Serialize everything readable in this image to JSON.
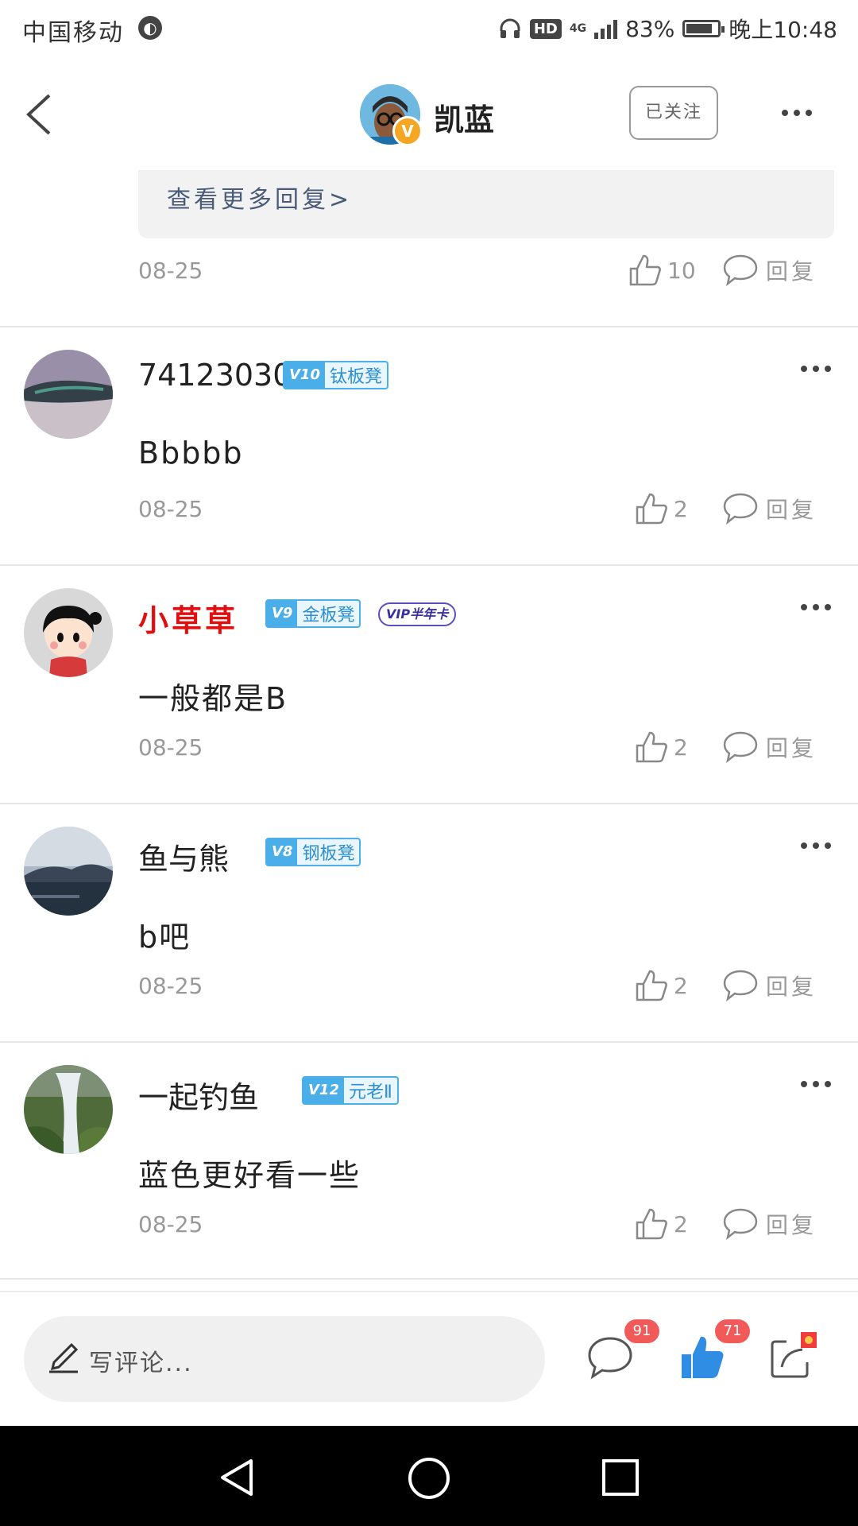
{
  "status_bar": {
    "carrier": "中国移动",
    "network": "4G",
    "hd_label": "HD",
    "battery": "83%",
    "time": "晚上10:48",
    "battery_level": 0.83
  },
  "header": {
    "user_name": "凯蓝",
    "follow_label": "已关注",
    "verified_badge": "V"
  },
  "partial_item": {
    "more_replies": "查看更多回复>",
    "date": "08-25",
    "likes": "10",
    "reply_label": "回复"
  },
  "comments": [
    {
      "name": "74123030",
      "level_v": "V10",
      "level_title": "钛板凳",
      "text": "Bbbbb",
      "date": "08-25",
      "likes": "2",
      "reply_label": "回复"
    },
    {
      "name": "小草草",
      "level_v": "V9",
      "level_title": "金板凳",
      "vip": "VIP半年卡",
      "text": "一般都是B",
      "date": "08-25",
      "likes": "2",
      "reply_label": "回复"
    },
    {
      "name": "鱼与熊",
      "level_v": "V8",
      "level_title": "钢板凳",
      "text": "b吧",
      "date": "08-25",
      "likes": "2",
      "reply_label": "回复"
    },
    {
      "name": "一起钓鱼",
      "level_v": "V12",
      "level_title": "元老Ⅱ",
      "text": "蓝色更好看一些",
      "date": "08-25",
      "likes": "2",
      "reply_label": "回复"
    }
  ],
  "bottom_bar": {
    "write_placeholder": "写评论...",
    "comment_count": "91",
    "like_count": "71"
  },
  "colors": {
    "accent_blue": "#2b8fd1",
    "like_blue": "#2f8de4",
    "badge_red": "#f25a5a",
    "name_red": "#e01010"
  }
}
